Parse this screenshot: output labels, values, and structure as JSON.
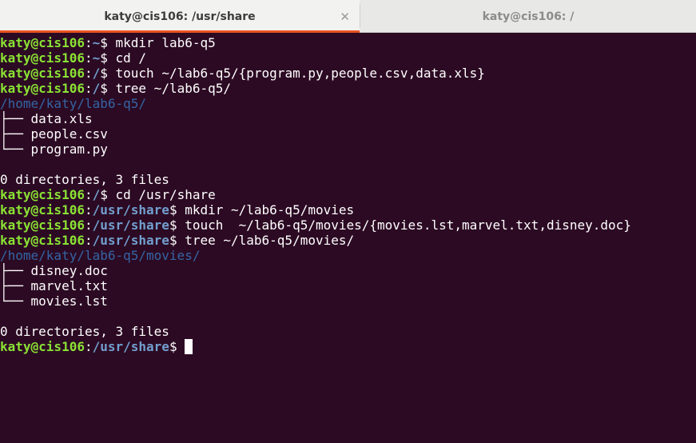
{
  "tabs": [
    {
      "title": "katy@cis106: /usr/share",
      "active": true,
      "close_icon": "close-icon"
    },
    {
      "title": "katy@cis106: /",
      "active": false
    }
  ],
  "colors": {
    "background": "#2c0a23",
    "prompt_user": "#8ae234",
    "prompt_path": "#729fcf",
    "directory": "#3465a4",
    "tab_accent": "#e95420"
  },
  "terminal": {
    "lines": [
      {
        "type": "prompt",
        "user": "katy@cis106",
        "path": "~",
        "cmd": "mkdir lab6-q5"
      },
      {
        "type": "prompt",
        "user": "katy@cis106",
        "path": "~",
        "cmd": "cd /"
      },
      {
        "type": "prompt",
        "user": "katy@cis106",
        "path": "/",
        "cmd": "touch ~/lab6-q5/{program.py,people.csv,data.xls}"
      },
      {
        "type": "prompt",
        "user": "katy@cis106",
        "path": "/",
        "cmd": "tree ~/lab6-q5/"
      },
      {
        "type": "dir",
        "text": "/home/katy/lab6-q5/"
      },
      {
        "type": "text",
        "text": "├── data.xls"
      },
      {
        "type": "text",
        "text": "├── people.csv"
      },
      {
        "type": "text",
        "text": "└── program.py"
      },
      {
        "type": "text",
        "text": ""
      },
      {
        "type": "text",
        "text": "0 directories, 3 files"
      },
      {
        "type": "prompt",
        "user": "katy@cis106",
        "path": "/",
        "cmd": "cd /usr/share"
      },
      {
        "type": "prompt",
        "user": "katy@cis106",
        "path": "/usr/share",
        "cmd": "mkdir ~/lab6-q5/movies"
      },
      {
        "type": "prompt",
        "user": "katy@cis106",
        "path": "/usr/share",
        "cmd": "touch  ~/lab6-q5/movies/{movies.lst,marvel.txt,disney.doc}"
      },
      {
        "type": "prompt",
        "user": "katy@cis106",
        "path": "/usr/share",
        "cmd": "tree ~/lab6-q5/movies/"
      },
      {
        "type": "dir",
        "text": "/home/katy/lab6-q5/movies/"
      },
      {
        "type": "text",
        "text": "├── disney.doc"
      },
      {
        "type": "text",
        "text": "├── marvel.txt"
      },
      {
        "type": "text",
        "text": "└── movies.lst"
      },
      {
        "type": "text",
        "text": ""
      },
      {
        "type": "text",
        "text": "0 directories, 3 files"
      },
      {
        "type": "prompt",
        "user": "katy@cis106",
        "path": "/usr/share",
        "cmd": "",
        "cursor": true
      }
    ]
  }
}
